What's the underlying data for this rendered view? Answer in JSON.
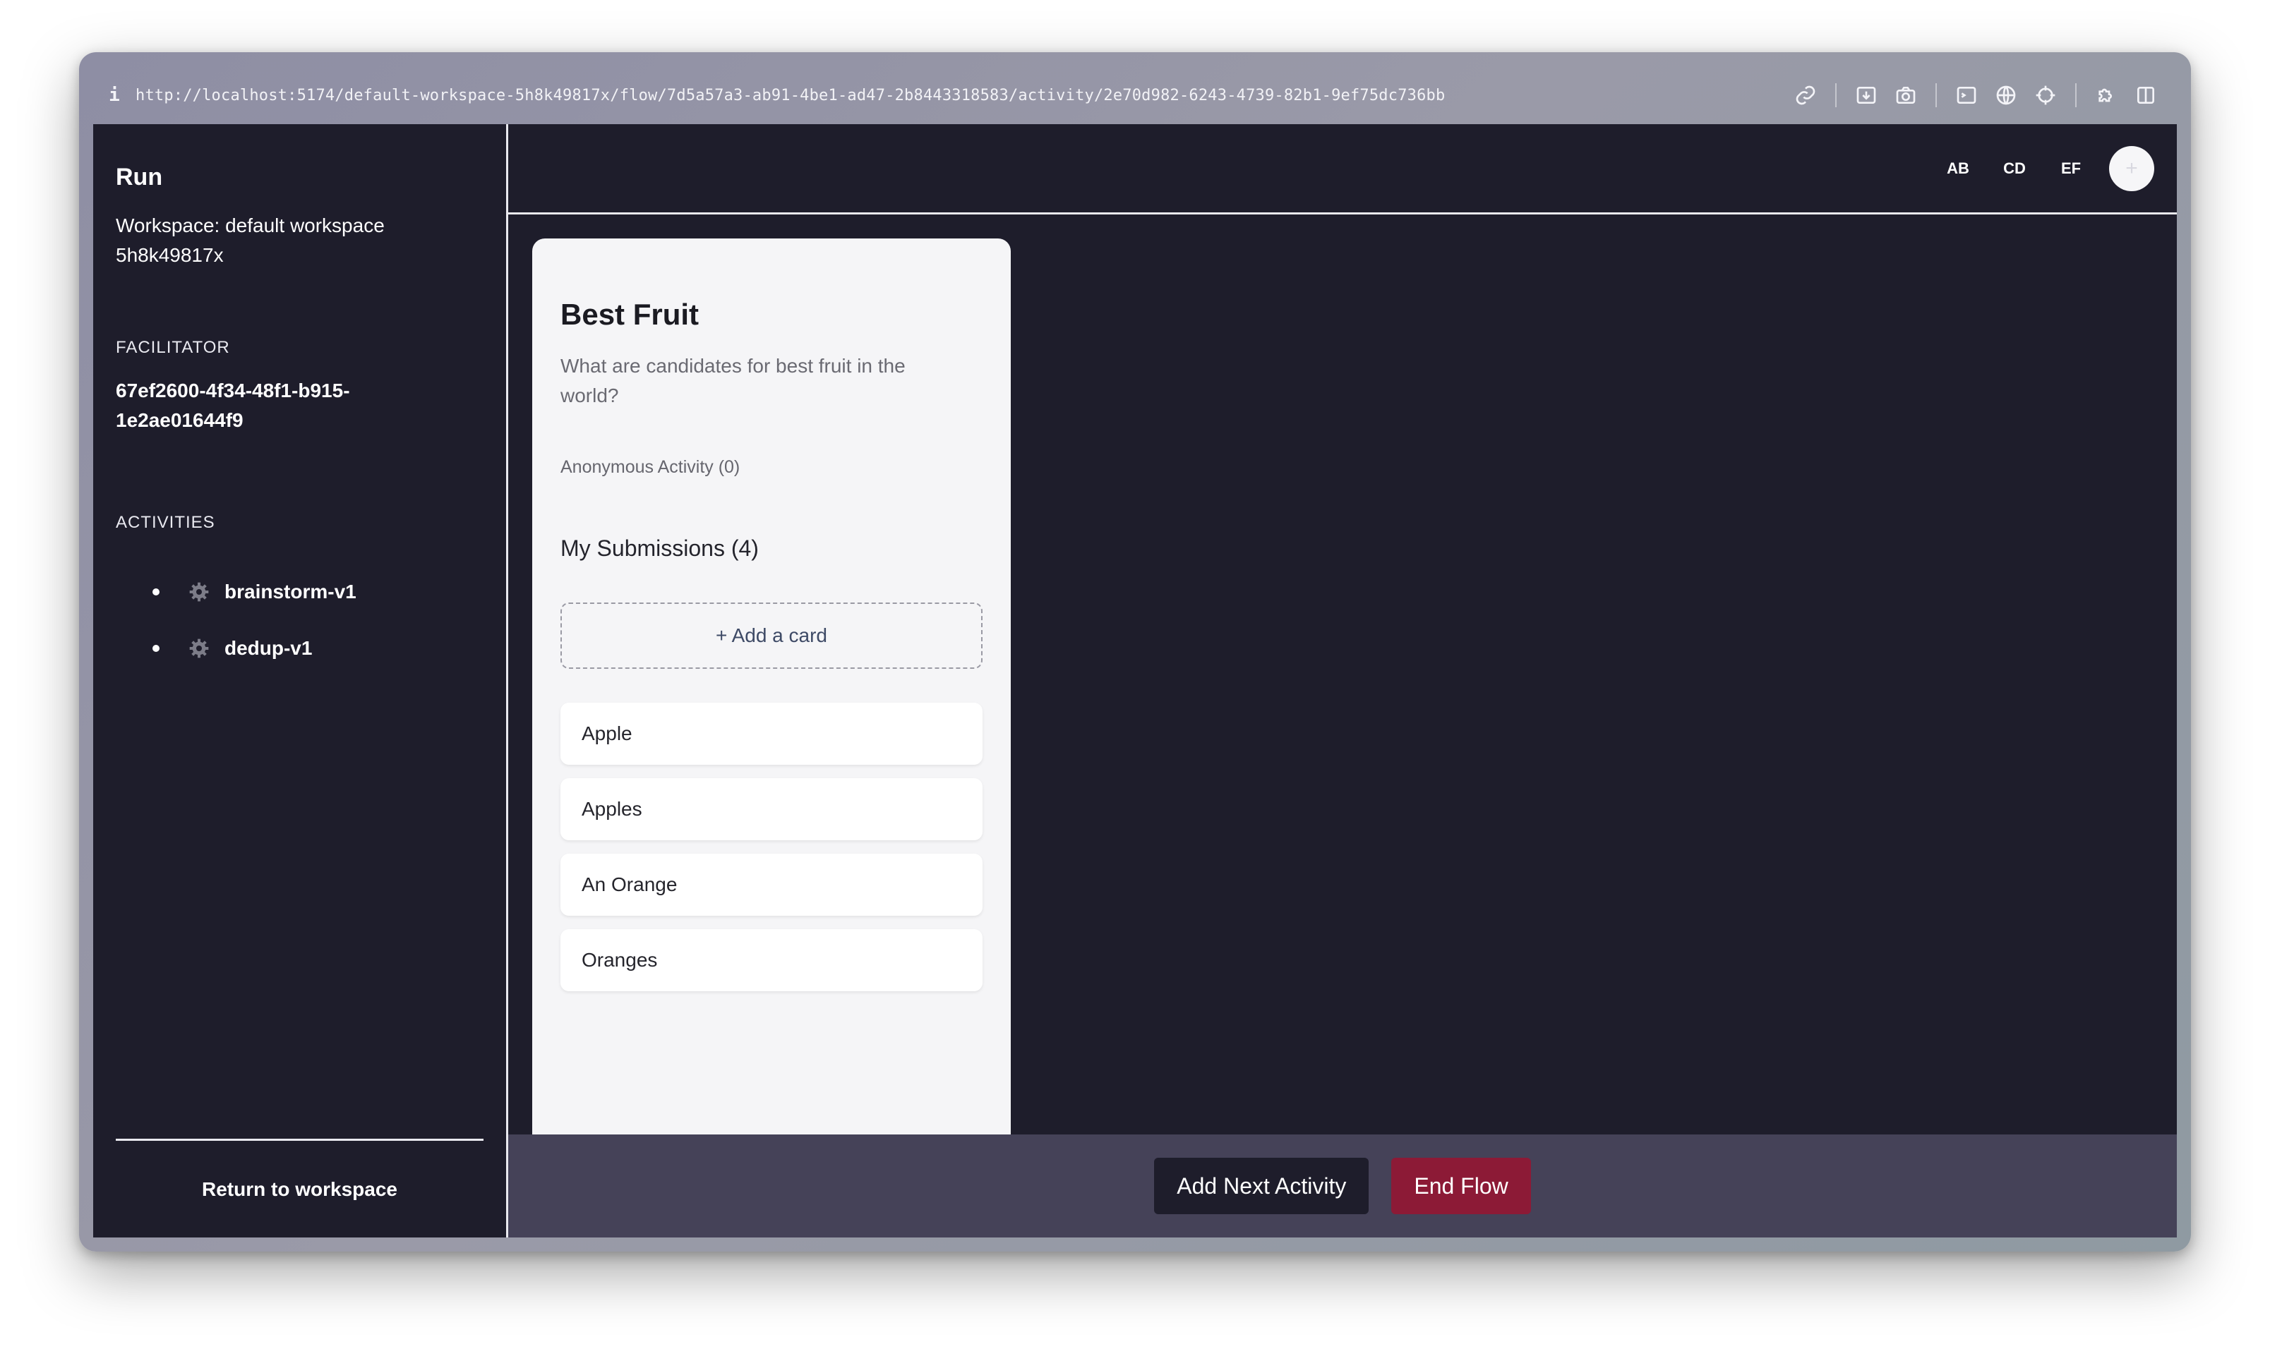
{
  "browser": {
    "url": "http://localhost:5174/default-workspace-5h8k49817x/flow/7d5a57a3-ab91-4be1-ad47-2b8443318583/activity/2e70d982-6243-4739-82b1-9ef75dc736bb",
    "info_icon": "i",
    "tools": [
      "link-icon",
      "download-icon",
      "camera-icon",
      "terminal-icon",
      "globe-icon",
      "crosshair-icon",
      "puzzle-icon",
      "sidebar-icon"
    ]
  },
  "sidebar": {
    "title": "Run",
    "workspace": "Workspace: default workspace 5h8k49817x",
    "facilitator_label": "FACILITATOR",
    "facilitator_id": "67ef2600-4f34-48f1-b915-1e2ae01644f9",
    "activities_label": "ACTIVITIES",
    "activities": [
      {
        "label": "brainstorm-v1",
        "icon": "gear-icon"
      },
      {
        "label": "dedup-v1",
        "icon": "gear-icon"
      }
    ],
    "return_label": "Return to workspace"
  },
  "topbar": {
    "participants": [
      "AB",
      "CD",
      "EF"
    ],
    "add_participant_icon": "+"
  },
  "panel": {
    "title": "Best Fruit",
    "question": "What are candidates for best fruit in the world?",
    "anonymous": "Anonymous Activity (0)",
    "my_submissions": "My Submissions (4)",
    "add_card": "+ Add a card",
    "cards": [
      "Apple",
      "Apples",
      "An Orange",
      "Oranges"
    ]
  },
  "actions": {
    "add_next": "Add Next Activity",
    "end_flow": "End Flow"
  },
  "colors": {
    "app_bg": "#1e1d2b",
    "bottom_bar": "#454258",
    "end_flow": "#8c1a36",
    "panel_bg": "#f5f5f7"
  }
}
